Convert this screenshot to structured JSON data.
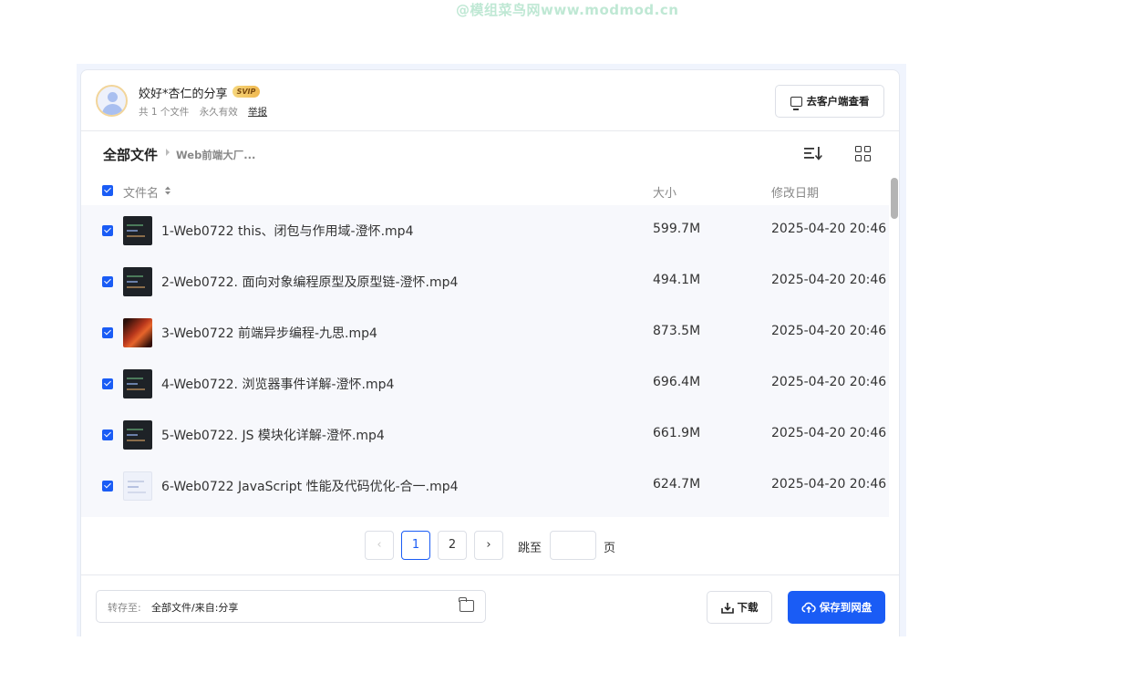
{
  "watermark": "@模组菜鸟网www.modmod.cn",
  "share": {
    "owner_title": "姣好*杏仁的分享",
    "badge": "SVIP",
    "file_count": "共 1 个文件",
    "validity": "永久有效",
    "report_label": "举报",
    "client_button": "去客户端查看"
  },
  "breadcrumb": {
    "root": "全部文件",
    "current": "Web前端大厂..."
  },
  "table": {
    "headers": {
      "name": "文件名",
      "size": "大小",
      "date": "修改日期"
    },
    "rows": [
      {
        "name": "1-Web0722 this、闭包与作用域-澄怀.mp4",
        "size": "599.7M",
        "date": "2025-04-20 20:46",
        "thumb": "code"
      },
      {
        "name": "2-Web0722. 面向对象编程原型及原型链-澄怀.mp4",
        "size": "494.1M",
        "date": "2025-04-20 20:46",
        "thumb": "code"
      },
      {
        "name": "3-Web0722 前端异步编程-九思.mp4",
        "size": "873.5M",
        "date": "2025-04-20 20:46",
        "thumb": "orange"
      },
      {
        "name": "4-Web0722. 浏览器事件详解-澄怀.mp4",
        "size": "696.4M",
        "date": "2025-04-20 20:46",
        "thumb": "code"
      },
      {
        "name": "5-Web0722. JS 模块化详解-澄怀.mp4",
        "size": "661.9M",
        "date": "2025-04-20 20:46",
        "thumb": "code"
      },
      {
        "name": "6-Web0722 JavaScript 性能及代码优化-合一.mp4",
        "size": "624.7M",
        "date": "2025-04-20 20:46",
        "thumb": "light"
      }
    ]
  },
  "pagination": {
    "prev": "‹",
    "pages": [
      "1",
      "2"
    ],
    "current": "1",
    "next": "›",
    "jump_prefix": "跳至",
    "jump_suffix": "页",
    "jump_value": ""
  },
  "footer": {
    "save_to_label": "转存至:",
    "save_to_path": "全部文件/来自:分享",
    "download_label": "下载",
    "save_label": "保存到网盘"
  },
  "colors": {
    "accent": "#1a5cf5",
    "svip": "#f0b84f"
  }
}
